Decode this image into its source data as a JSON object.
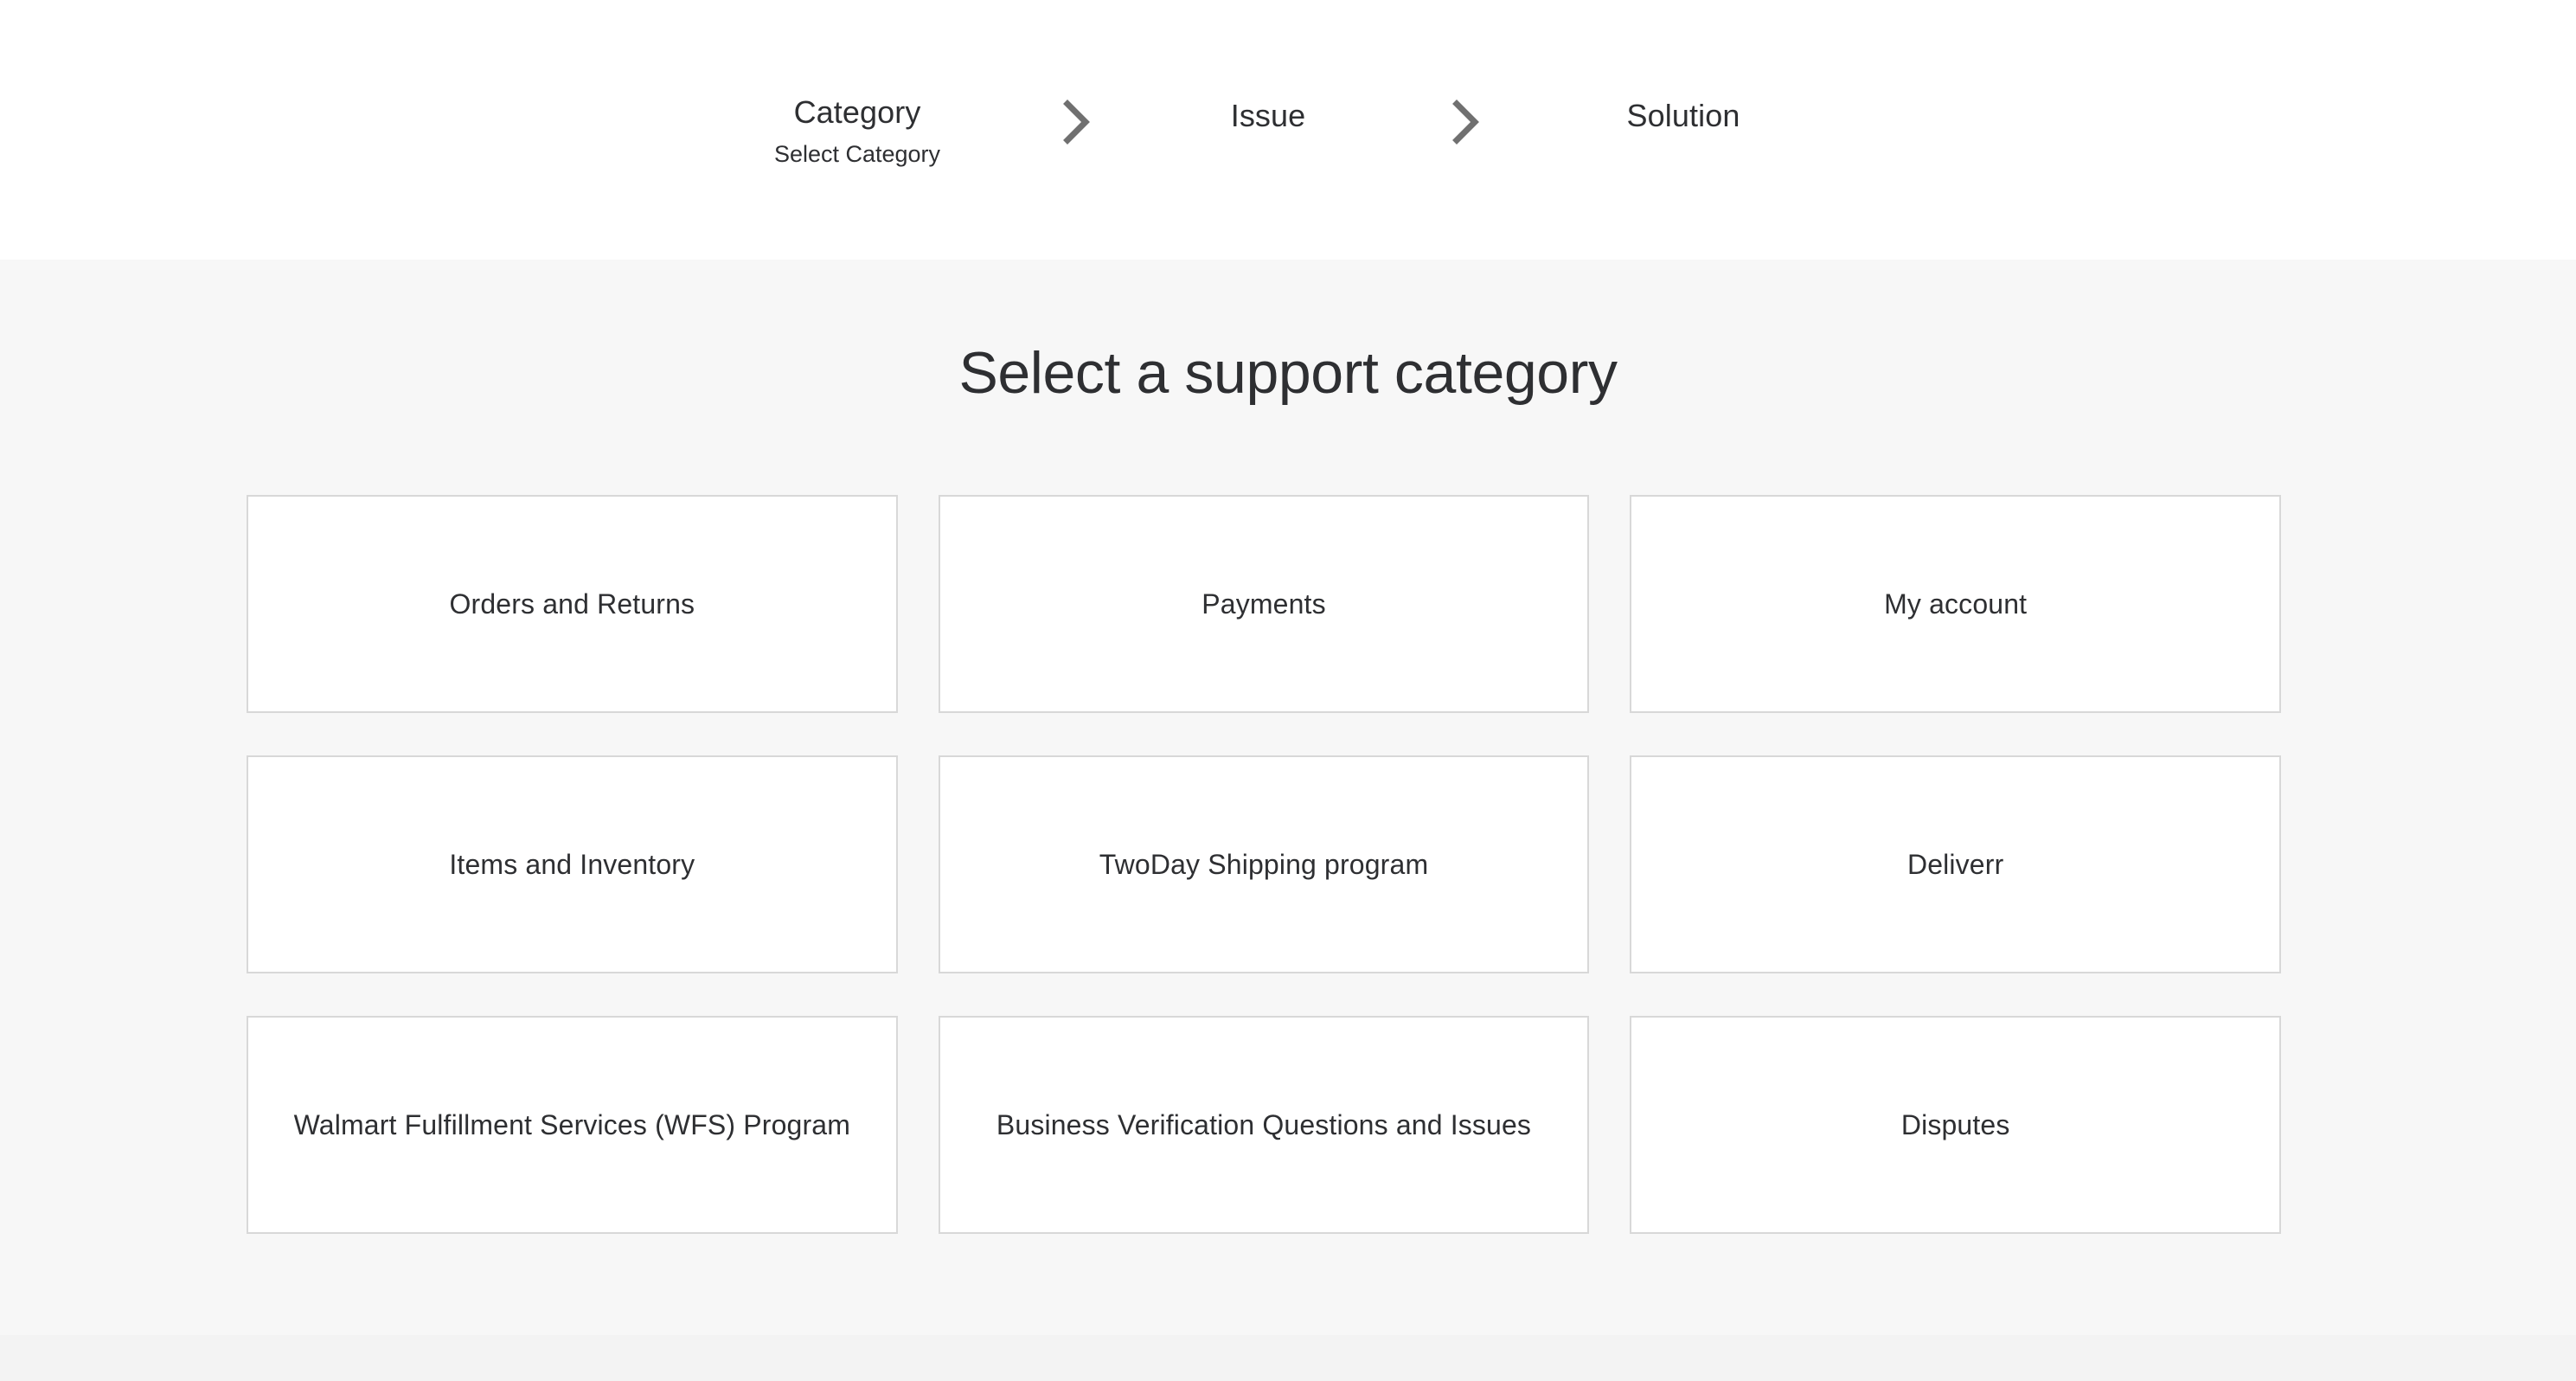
{
  "theme": {
    "page_bg": "#ffffff",
    "content_bg": "#f7f7f7",
    "footer_bg": "#f3f3f3",
    "card_bg": "#ffffff",
    "card_border": "#d8d8d8",
    "text": "#2e2f32",
    "chevron": "#707070"
  },
  "stepper": {
    "steps": [
      {
        "title": "Category",
        "subtitle": "Select Category",
        "state": "current"
      },
      {
        "title": "Issue",
        "subtitle": "",
        "state": "upcoming"
      },
      {
        "title": "Solution",
        "subtitle": "",
        "state": "upcoming"
      }
    ],
    "separator_icon": "chevron-right-icon"
  },
  "main": {
    "title": "Select a support category",
    "categories": [
      {
        "label": "Orders and Returns"
      },
      {
        "label": "Payments"
      },
      {
        "label": "My account"
      },
      {
        "label": "Items and Inventory"
      },
      {
        "label": "TwoDay Shipping program"
      },
      {
        "label": "Deliverr"
      },
      {
        "label": "Walmart Fulfillment Services (WFS) Program"
      },
      {
        "label": "Business Verification Questions and Issues"
      },
      {
        "label": "Disputes"
      }
    ]
  }
}
